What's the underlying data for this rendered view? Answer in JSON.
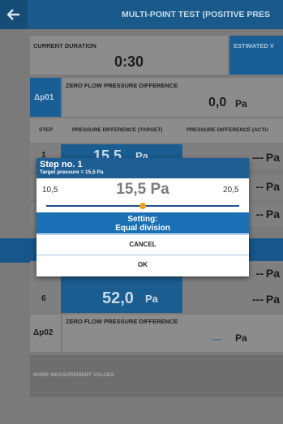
{
  "header": {
    "title": "MULTI-POINT TEST (POSITIVE PRES"
  },
  "duration": {
    "label": "CURRENT DURATION",
    "value": "0:30",
    "estimated_label": "ESTIMATED V"
  },
  "dp01": {
    "label": "Δp01",
    "title": "ZERO FLOW PRESSURE DIFFERENCE",
    "value": "0,0",
    "unit": "Pa"
  },
  "table": {
    "headers": [
      "STEP",
      "PRESSURE DIFFERENCE (TARGET)",
      "PRESSURE DIFFERENCE (ACTU"
    ],
    "rows": [
      {
        "step": "1",
        "target": "15,5",
        "unit": "Pa",
        "actual": "---",
        "actual_unit": "Pa"
      },
      {
        "actual": "--",
        "actual_unit": "Pa"
      },
      {
        "actual": "--",
        "actual_unit": "Pa"
      },
      {
        "actual": "--",
        "actual_unit": "Pa"
      }
    ],
    "row6": {
      "step": "6",
      "target": "52,0",
      "unit": "Pa",
      "actual": "---",
      "actual_unit": "Pa"
    }
  },
  "dp02": {
    "label": "Δp02",
    "title": "ZERO FLOW PRESSURE DIFFERENCE",
    "value": "---",
    "unit": "Pa"
  },
  "more": {
    "label": "MORE MEASUREMENT VALUES"
  },
  "dialog": {
    "title": "Step no. 1",
    "subtitle": "Target pressure = 15,5 Pa",
    "min": "10,5",
    "value": "15,5 Pa",
    "max": "20,5",
    "slider_fraction": 0.5,
    "setting_label": "Setting:",
    "setting_value": "Equal division",
    "cancel": "CANCEL",
    "ok": "OK"
  },
  "colors": {
    "header": "#1a5a8a",
    "accent": "#1a6fb5",
    "slider_thumb": "#f0a020"
  }
}
